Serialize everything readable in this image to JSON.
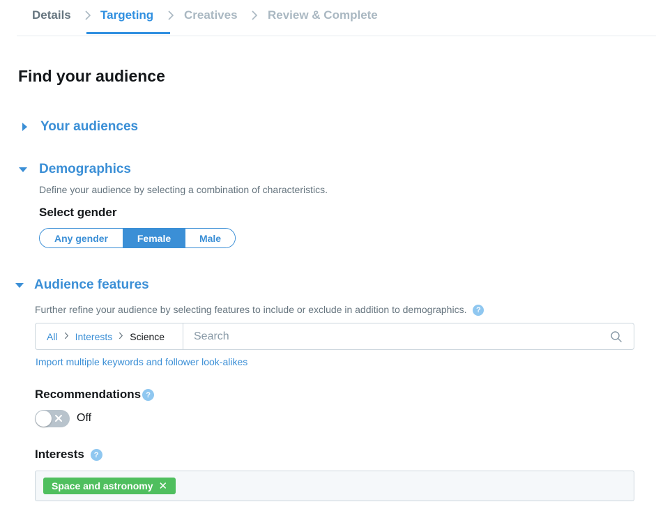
{
  "stepper": {
    "steps": [
      {
        "label": "Details",
        "state": "done"
      },
      {
        "label": "Targeting",
        "state": "active"
      },
      {
        "label": "Creatives",
        "state": "todo"
      },
      {
        "label": "Review & Complete",
        "state": "todo"
      }
    ]
  },
  "page": {
    "title": "Find your audience"
  },
  "sections": {
    "your_audiences": {
      "title": "Your audiences",
      "expanded": false
    },
    "demographics": {
      "title": "Demographics",
      "expanded": true,
      "description": "Define your audience by selecting a combination of characteristics.",
      "gender_label": "Select gender",
      "gender_options": [
        "Any gender",
        "Female",
        "Male"
      ],
      "gender_selected": "Female"
    },
    "audience_features": {
      "title": "Audience features",
      "expanded": true,
      "description": "Further refine your audience by selecting features to include or exclude in addition to demographics.",
      "breadcrumb": [
        "All",
        "Interests",
        "Science"
      ],
      "search_placeholder": "Search",
      "import_link": "Import multiple keywords and follower look-alikes",
      "recommendations_label": "Recommendations",
      "recommendations_state": "Off",
      "interests_label": "Interests",
      "interest_tags": [
        "Space and astronomy"
      ],
      "help_glyph": "?",
      "tag_close_glyph": "✕"
    }
  },
  "colors": {
    "accent": "#3b8fd6",
    "tag_green": "#4fbf5e",
    "muted": "#66757f",
    "disabled": "#aab8c2"
  },
  "icons": [
    "chevron-right-icon",
    "caret-right-icon",
    "caret-down-icon",
    "help-icon",
    "search-icon",
    "close-icon"
  ]
}
